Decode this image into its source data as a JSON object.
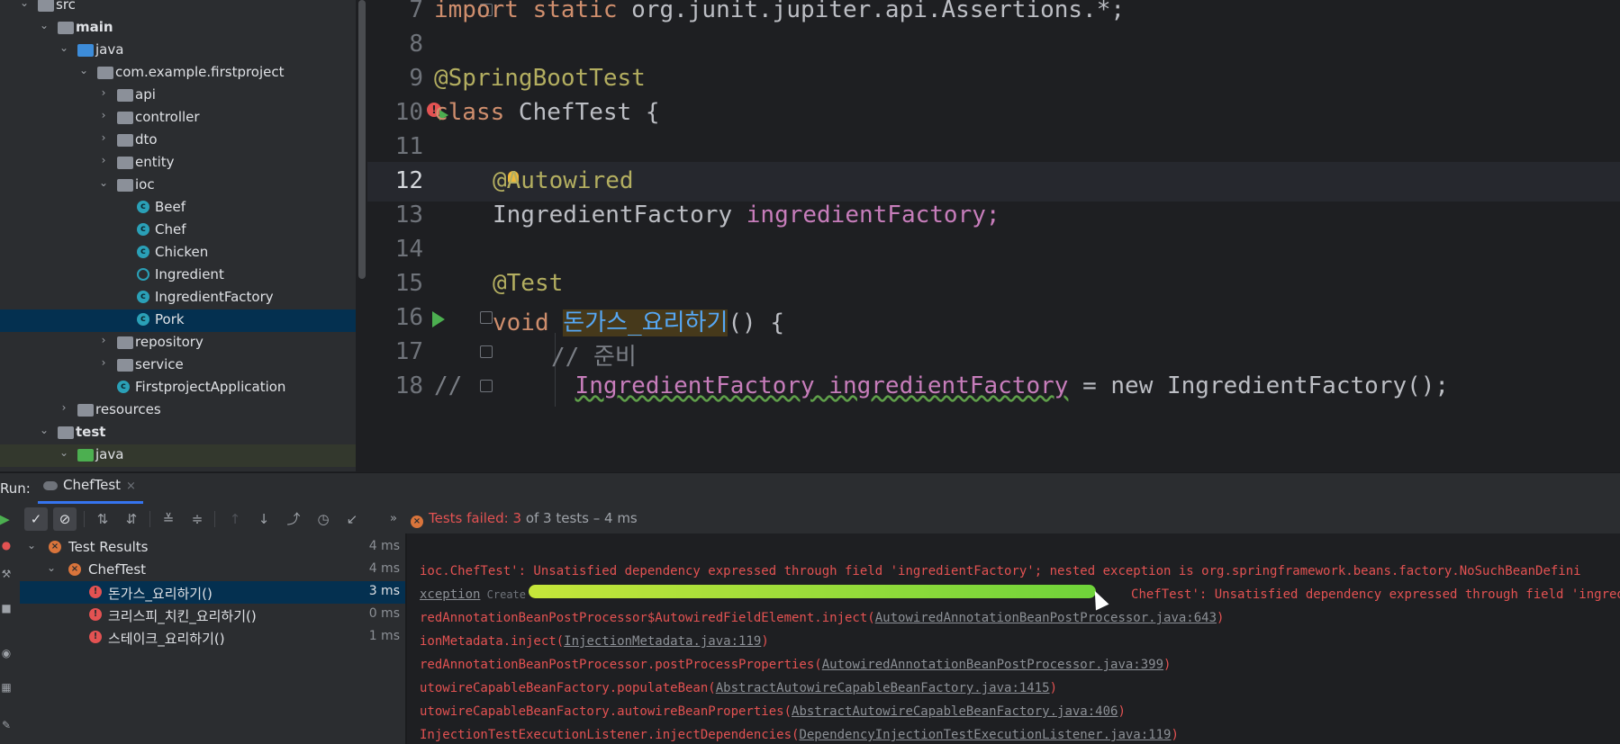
{
  "project_tree": {
    "rows": [
      {
        "label": "src",
        "depth": 0,
        "arrow": "v",
        "icon": "folder-icon",
        "bold": false
      },
      {
        "label": "main",
        "depth": 1,
        "arrow": "v",
        "icon": "folder-icon",
        "bold": true
      },
      {
        "label": "java",
        "depth": 2,
        "arrow": "v",
        "icon": "source-folder-icon",
        "bold": false
      },
      {
        "label": "com.example.firstproject",
        "depth": 3,
        "arrow": "v",
        "icon": "package-icon",
        "bold": false
      },
      {
        "label": "api",
        "depth": 4,
        "arrow": ">",
        "icon": "package-icon",
        "bold": false
      },
      {
        "label": "controller",
        "depth": 4,
        "arrow": ">",
        "icon": "package-icon",
        "bold": false
      },
      {
        "label": "dto",
        "depth": 4,
        "arrow": ">",
        "icon": "package-icon",
        "bold": false
      },
      {
        "label": "entity",
        "depth": 4,
        "arrow": ">",
        "icon": "package-icon",
        "bold": false
      },
      {
        "label": "ioc",
        "depth": 4,
        "arrow": "v",
        "icon": "package-icon",
        "bold": false
      },
      {
        "label": "Beef",
        "depth": 5,
        "arrow": "",
        "icon": "class-icon",
        "bold": false
      },
      {
        "label": "Chef",
        "depth": 5,
        "arrow": "",
        "icon": "class-icon",
        "bold": false
      },
      {
        "label": "Chicken",
        "depth": 5,
        "arrow": "",
        "icon": "class-icon",
        "bold": false
      },
      {
        "label": "Ingredient",
        "depth": 5,
        "arrow": "",
        "icon": "abstract-class-icon",
        "bold": false
      },
      {
        "label": "IngredientFactory",
        "depth": 5,
        "arrow": "",
        "icon": "class-icon",
        "bold": false
      },
      {
        "label": "Pork",
        "depth": 5,
        "arrow": "",
        "icon": "class-icon",
        "bold": false,
        "selected": true
      },
      {
        "label": "repository",
        "depth": 4,
        "arrow": ">",
        "icon": "package-icon",
        "bold": false
      },
      {
        "label": "service",
        "depth": 4,
        "arrow": ">",
        "icon": "package-icon",
        "bold": false
      },
      {
        "label": "FirstprojectApplication",
        "depth": 4,
        "arrow": "",
        "icon": "spring-app-icon",
        "bold": false
      },
      {
        "label": "resources",
        "depth": 2,
        "arrow": ">",
        "icon": "folder-icon",
        "bold": false
      },
      {
        "label": "test",
        "depth": 1,
        "arrow": "v",
        "icon": "folder-icon",
        "bold": true
      },
      {
        "label": "java",
        "depth": 2,
        "arrow": "v",
        "icon": "test-folder-icon",
        "bold": false,
        "test_selected": true
      }
    ]
  },
  "editor": {
    "lines": [
      {
        "num": "7"
      },
      {
        "num": "8"
      },
      {
        "num": "9"
      },
      {
        "num": "10"
      },
      {
        "num": "11"
      },
      {
        "num": "12"
      },
      {
        "num": "13"
      },
      {
        "num": "14"
      },
      {
        "num": "15"
      },
      {
        "num": "16"
      },
      {
        "num": "17"
      },
      {
        "num": "18"
      }
    ],
    "code": {
      "l7_kw": "import static",
      "l7_rest": " org.junit.jupiter.api.Assertions.*;",
      "l9_ann": "@SpringBootTest",
      "l10_kw": "class",
      "l10_rest": " ChefTest {",
      "l12_ann": "@Autowired",
      "l13_type": "IngredientFactory ",
      "l13_field": "ingredientFactory;",
      "l15_ann": "@Test",
      "l16_kw": "void ",
      "l16_name": "돈가스_요리하기",
      "l16_rest": "() {",
      "l17_cmt": "// 준비",
      "l18_prefix": "//",
      "l18_a": "IngredientFactory ingredientFactory",
      "l18_b": " = new IngredientFactory();"
    }
  },
  "run_panel": {
    "label": "Run:",
    "tab_label": "ChefTest",
    "tab_close": "×",
    "status_prefix": "Tests failed: 3",
    "status_suffix": " of 3 tests – 4 ms",
    "more": "»"
  },
  "test_tree": {
    "rows": [
      {
        "label": "Test Results",
        "time": "4 ms"
      },
      {
        "label": "ChefTest",
        "time": "4 ms"
      },
      {
        "label": "돈가스_요리하기()",
        "time": "3 ms"
      },
      {
        "label": "크리스피_치킨_요리하기()",
        "time": "0 ms"
      },
      {
        "label": "스테이크_요리하기()",
        "time": "1 ms"
      }
    ]
  },
  "console": {
    "line1": "ioc.ChefTest': Unsatisfied dependency expressed through field 'ingredientFactory'; nested exception is org.springframework.beans.factory.NoSuchBeanDefini",
    "line2_a": "xception",
    "line2_b": " Create",
    "line2_c": "ChefTest': Unsatisfied dependency expressed through field 'ingredie",
    "line3_a": "redAnnotationBeanPostProcessor$AutowiredFieldElement.inject(",
    "line3_b": "AutowiredAnnotationBeanPostProcessor.java:643",
    "line3_c": ")",
    "line4_a": "ionMetadata.inject(",
    "line4_b": "InjectionMetadata.java:119",
    "line4_c": ")",
    "line5_a": "redAnnotationBeanPostProcessor.postProcessProperties(",
    "line5_b": "AutowiredAnnotationBeanPostProcessor.java:399",
    "line5_c": ")",
    "line6_a": "utowireCapableBeanFactory.populateBean(",
    "line6_b": "AbstractAutowireCapableBeanFactory.java:1415",
    "line6_c": ")",
    "line7_a": "utowireCapableBeanFactory.autowireBeanProperties(",
    "line7_b": "AbstractAutowireCapableBeanFactory.java:406",
    "line7_c": ")",
    "line8_a": "InjectionTestExecutionListener.injectDependencies(",
    "line8_b": "DependencyInjectionTestExecutionListener.java:119",
    "line8_c": ")"
  },
  "colors": {
    "error_red": "#e35252",
    "keyword_orange": "#cf8e6d",
    "annotation_yellow": "#b3ae60",
    "field_purple": "#c77dbb",
    "selection_blue": "#043050",
    "run_green": "#4caf50",
    "highlight_green": "#6fd43a"
  }
}
